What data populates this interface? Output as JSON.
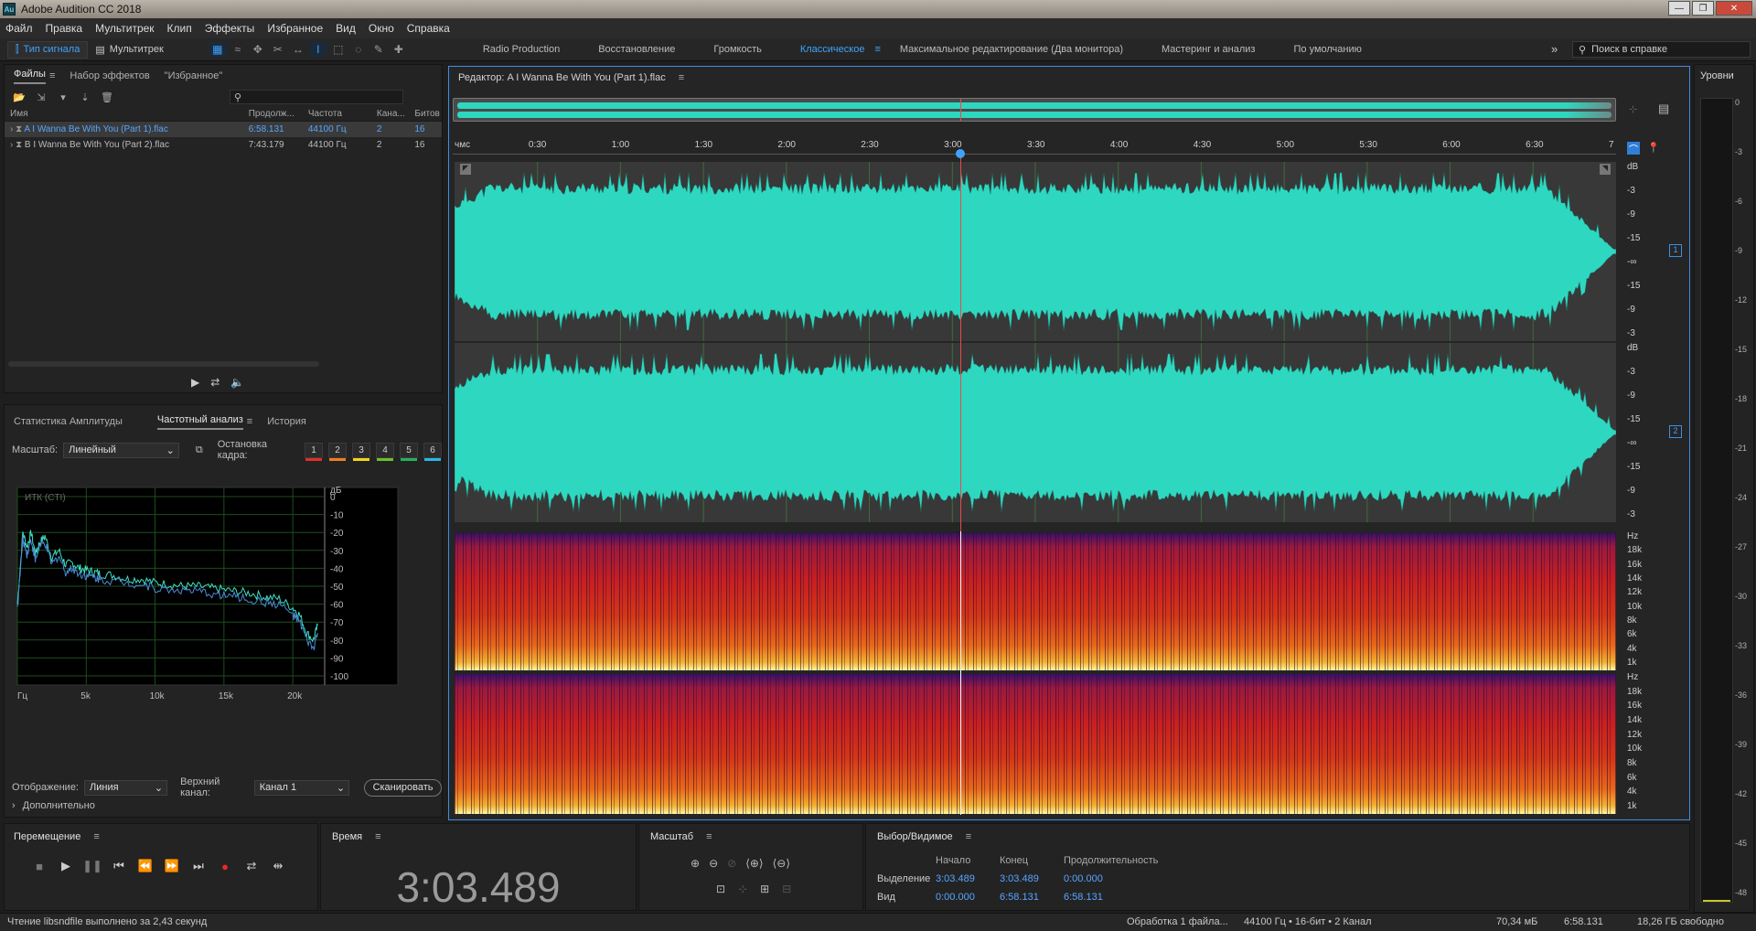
{
  "app": {
    "title": "Adobe Audition CC 2018",
    "logo": "Au"
  },
  "menu": [
    "Файл",
    "Правка",
    "Мультитрек",
    "Клип",
    "Эффекты",
    "Избранное",
    "Вид",
    "Окно",
    "Справка"
  ],
  "toolbar": {
    "waveform_label": "Тип сигнала",
    "multitrack_label": "Мультитрек",
    "workspaces": [
      "Radio Production",
      "Восстановление",
      "Громкость",
      "Классическое",
      "Максимальное редактирование (Два монитора)",
      "Мастеринг и анализ",
      "По умолчанию"
    ],
    "active_workspace": "Классическое",
    "search_placeholder": "Поиск в справке"
  },
  "files_panel": {
    "tabs": [
      "Файлы",
      "Набор эффектов",
      "\"Избранное\""
    ],
    "columns": [
      "Имя",
      "Продолж...",
      "Частота",
      "Кана...",
      "Битов"
    ],
    "files": [
      {
        "name": "A I Wanna Be With You (Part 1).flac",
        "duration": "6:58.131",
        "rate": "44100 Гц",
        "channels": "2",
        "bits": "16"
      },
      {
        "name": "B I Wanna Be With You (Part 2).flac",
        "duration": "7:43.179",
        "rate": "44100 Гц",
        "channels": "2",
        "bits": "16"
      }
    ]
  },
  "analysis_panel": {
    "tabs": [
      "Статистика Амплитуды",
      "Частотный анализ",
      "История"
    ],
    "scale_label": "Масштаб:",
    "scale_value": "Линейный",
    "freeze_label": "Остановка кадра:",
    "freeze_buttons": [
      "1",
      "2",
      "3",
      "4",
      "5",
      "6"
    ],
    "freeze_colors": [
      "#e0302a",
      "#f07d1e",
      "#f2d51a",
      "#6bc22a",
      "#27b05c",
      "#29b6e6"
    ],
    "chart_title": "ИТК (CTI)",
    "display_label": "Отображение:",
    "display_value": "Линия",
    "channel_label": "Верхний канал:",
    "channel_value": "Канал 1",
    "scan_button": "Сканировать",
    "more_label": "Дополнительно"
  },
  "chart_data": {
    "type": "line",
    "title": "ИТК (CTI)",
    "xlabel": "",
    "ylabel": "дБ",
    "xlim": [
      0,
      22050
    ],
    "ylim": [
      -100,
      0
    ],
    "x_ticks": [
      "Гц",
      "5k",
      "10k",
      "15k",
      "20k"
    ],
    "y_ticks": [
      "дБ",
      "0",
      "-10",
      "-20",
      "-30",
      "-40",
      "-50",
      "-60",
      "-70",
      "-80",
      "-90",
      "-100"
    ],
    "grid": true,
    "series": [
      {
        "x": [
          0,
          400,
          700,
          1000,
          1300,
          1600,
          2000,
          2500,
          3000,
          3500,
          4000,
          4500,
          5000,
          5500,
          6000,
          7000,
          8000,
          9000,
          10000,
          11000,
          12000,
          13000,
          14000,
          15000,
          16000,
          17000,
          18000,
          19000,
          20000,
          20500,
          21000,
          21500,
          21800
        ],
        "values": [
          -60,
          -20,
          -28,
          -20,
          -32,
          -26,
          -22,
          -34,
          -30,
          -38,
          -37,
          -40,
          -41,
          -42,
          -43,
          -44,
          -46,
          -46,
          -48,
          -49,
          -50,
          -50,
          -51,
          -52,
          -53,
          -54,
          -56,
          -57,
          -62,
          -66,
          -76,
          -80,
          -72
        ],
        "color": "#3fe0c4"
      },
      {
        "x": [
          0,
          400,
          700,
          1000,
          1300,
          1600,
          2000,
          2500,
          3000,
          3500,
          4000,
          4500,
          5000,
          5500,
          6000,
          7000,
          8000,
          9000,
          10000,
          11000,
          12000,
          13000,
          14000,
          15000,
          16000,
          17000,
          18000,
          19000,
          20000,
          20500,
          21000,
          21500,
          21800
        ],
        "values": [
          -62,
          -24,
          -32,
          -24,
          -36,
          -28,
          -26,
          -38,
          -33,
          -42,
          -40,
          -43,
          -44,
          -45,
          -46,
          -47,
          -48,
          -49,
          -51,
          -52,
          -52,
          -53,
          -54,
          -55,
          -56,
          -58,
          -59,
          -60,
          -66,
          -70,
          -80,
          -85,
          -76
        ],
        "color": "#4a8bd6"
      }
    ]
  },
  "editor": {
    "title": "Редактор: A I Wanna Be With You (Part 1).flac",
    "timeline": [
      "чмс",
      "0:30",
      "1:00",
      "1:30",
      "2:00",
      "2:30",
      "3:00",
      "3:30",
      "4:00",
      "4:30",
      "5:00",
      "5:30",
      "6:00",
      "6:30",
      "7"
    ],
    "db_scale": [
      "dB",
      "-3",
      "-9",
      "-15",
      "-∞",
      "-15",
      "-9",
      "-3"
    ],
    "channel_labels": [
      "1",
      "2"
    ],
    "hz_scale": [
      "Hz",
      "18k",
      "16k",
      "14k",
      "12k",
      "10k",
      "8k",
      "6k",
      "4k",
      "1k"
    ],
    "playhead_fraction": 0.4354,
    "wave_color": "#2ed7c0"
  },
  "levels": {
    "title": "Уровни",
    "scale": [
      "0",
      "-3",
      "-6",
      "-9",
      "-12",
      "-15",
      "-18",
      "-21",
      "-24",
      "-27",
      "-30",
      "-33",
      "-36",
      "-39",
      "-42",
      "-45",
      "-48"
    ]
  },
  "transport": {
    "title": "Перемещение"
  },
  "time_panel": {
    "title": "Время",
    "value": "3:03.489"
  },
  "zoom_panel": {
    "title": "Масштаб"
  },
  "selection_panel": {
    "title": "Выбор/Видимое",
    "headers": [
      "Начало",
      "Конец",
      "Продолжительность"
    ],
    "rows": [
      {
        "label": "Выделение",
        "start": "3:03.489",
        "end": "3:03.489",
        "duration": "0:00.000"
      },
      {
        "label": "Вид",
        "start": "0:00.000",
        "end": "6:58.131",
        "duration": "6:58.131"
      }
    ]
  },
  "status": {
    "message": "Чтение libsndfile выполнено за 2,43 секунд",
    "processing": "Обработка 1 файла...",
    "format": "44100 Гц • 16-бит • 2 Канал",
    "size": "70,34 мБ",
    "duration": "6:58.131",
    "free": "18,26 ГБ свободно"
  }
}
